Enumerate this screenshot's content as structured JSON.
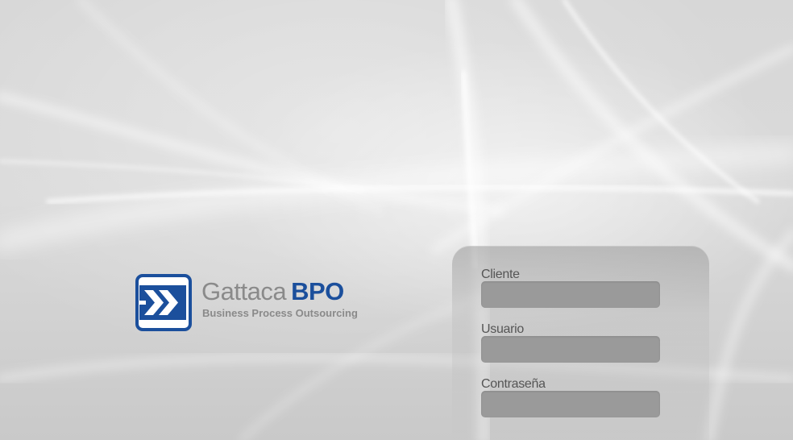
{
  "logo": {
    "name": "Gattaca",
    "name_accent": "BPO",
    "tagline": "Business Process Outsourcing",
    "icon": "double-arrow-icon",
    "colors": {
      "brand_blue": "#1b4f9c",
      "brand_gray": "#8a8a8a"
    }
  },
  "login": {
    "client_label": "Cliente",
    "client_value": "",
    "user_label": "Usuario",
    "user_value": "",
    "password_label": "Contraseña",
    "password_value": "",
    "colors": {
      "input_background": "#9a9a9a",
      "label_text": "#555555"
    }
  }
}
